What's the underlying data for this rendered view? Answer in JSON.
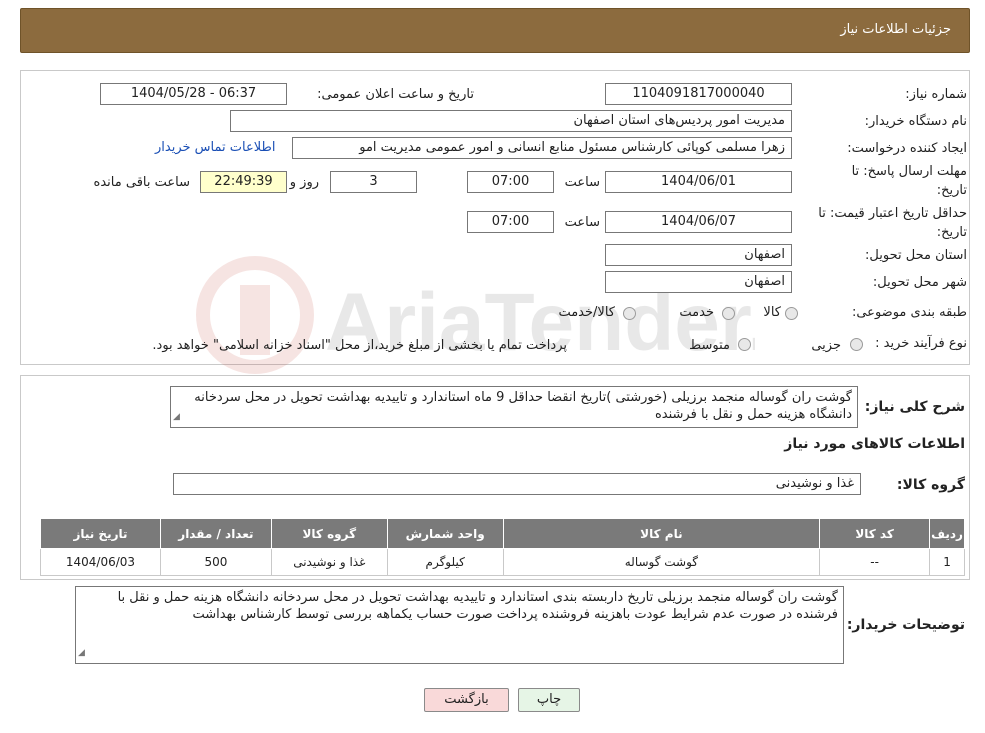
{
  "header": {
    "title": "جزئیات اطلاعات نیاز"
  },
  "form": {
    "need_number_label": "شماره نیاز:",
    "need_number": "1104091817000040",
    "announce_label": "تاریخ و ساعت اعلان عمومی:",
    "announce_value": "1404/05/28 - 06:37",
    "buyer_org_label": "نام دستگاه خریدار:",
    "buyer_org": "مدیریت امور پردیس‌های استان اصفهان",
    "creator_label": "ایجاد کننده درخواست:",
    "creator": "زهرا مسلمی کوپائی کارشناس مسئول منابع انسانی و امور عمومی مدیریت امو",
    "contact_link": "اطلاعات تماس خریدار",
    "deadline_label_1": "مهلت ارسال پاسخ: تا",
    "deadline_label_2": "تاریخ:",
    "deadline_date": "1404/06/01",
    "time_label": "ساعت",
    "deadline_time": "07:00",
    "days_value": "3",
    "days_label": "روز و",
    "remaining_time": "22:49:39",
    "remaining_label": "ساعت باقی مانده",
    "validity_label_1": "حداقل تاریخ اعتبار قیمت: تا",
    "validity_label_2": "تاریخ:",
    "validity_date": "1404/06/07",
    "validity_time": "07:00",
    "province_label": "استان محل تحویل:",
    "province": "اصفهان",
    "city_label": "شهر محل تحویل:",
    "city": "اصفهان",
    "category_label": "طبقه بندی موضوعی:",
    "category_options": [
      "کالا",
      "خدمت",
      "کالا/خدمت"
    ],
    "purchase_type_label": "نوع فرآیند خرید :",
    "purchase_options": [
      "جزیی",
      "متوسط"
    ],
    "purchase_note": "پرداخت تمام یا بخشی از مبلغ خرید،از محل \"اسناد خزانه اسلامی\" خواهد بود."
  },
  "summary": {
    "label": "شرح کلی نیاز:",
    "text": "گوشت ران گوساله منجمد برزیلی (خورشتی )تاریخ انقضا حداقل 9 ماه  استاندارد و تاییدیه بهداشت تحویل در محل سردخانه دانشگاه هزینه حمل و نقل با فرشنده",
    "items_title": "اطلاعات کالاهای مورد نیاز",
    "group_label": "گروه کالا:",
    "group_value": "غذا و نوشیدنی"
  },
  "table": {
    "headers": [
      "ردیف",
      "کد کالا",
      "نام کالا",
      "واحد شمارش",
      "گروه کالا",
      "تعداد / مقدار",
      "تاریخ نیاز"
    ],
    "rows": [
      [
        "1",
        "--",
        "گوشت گوساله",
        "کیلوگرم",
        "غذا و نوشیدنی",
        "500",
        "1404/06/03"
      ]
    ]
  },
  "buyer_notes": {
    "label": "توضیحات خریدار:",
    "text": "گوشت ران گوساله منجمد برزیلی تاریخ داربسته بندی استاندارد و تاییدیه بهداشت تحویل در محل سردخانه دانشگاه هزینه حمل و نقل با فرشنده در صورت عدم شرایط عودت باهزینه فروشنده پرداخت صورت حساب یکماهه بررسی توسط کارشناس بهداشت"
  },
  "buttons": {
    "print": "چاپ",
    "back": "بازگشت"
  },
  "watermark": "AriaTender.neT",
  "colors": {
    "header": "#8c6b3e",
    "link": "#1a4fb5",
    "back_button": "#f9d9d9",
    "print_button": "#e6f5e6"
  }
}
